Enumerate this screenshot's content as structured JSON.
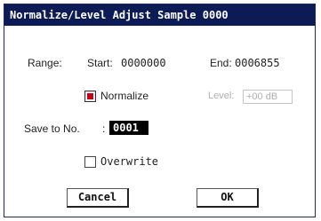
{
  "dialog": {
    "title": "Normalize/Level Adjust Sample 0000",
    "range_label": "Range:",
    "start_label": "Start:",
    "start_value": "0000000",
    "end_label": "End:",
    "end_value": "0006855",
    "normalize": {
      "label": "Normalize",
      "checked": true
    },
    "level": {
      "label": "Level:",
      "value": "+00 dB",
      "enabled": false
    },
    "save_to": {
      "label": "Save to No.",
      "colon": ":",
      "value": "0001"
    },
    "overwrite": {
      "label": "Overwrite",
      "checked": false
    },
    "cancel_label": "Cancel",
    "ok_label": "OK"
  }
}
